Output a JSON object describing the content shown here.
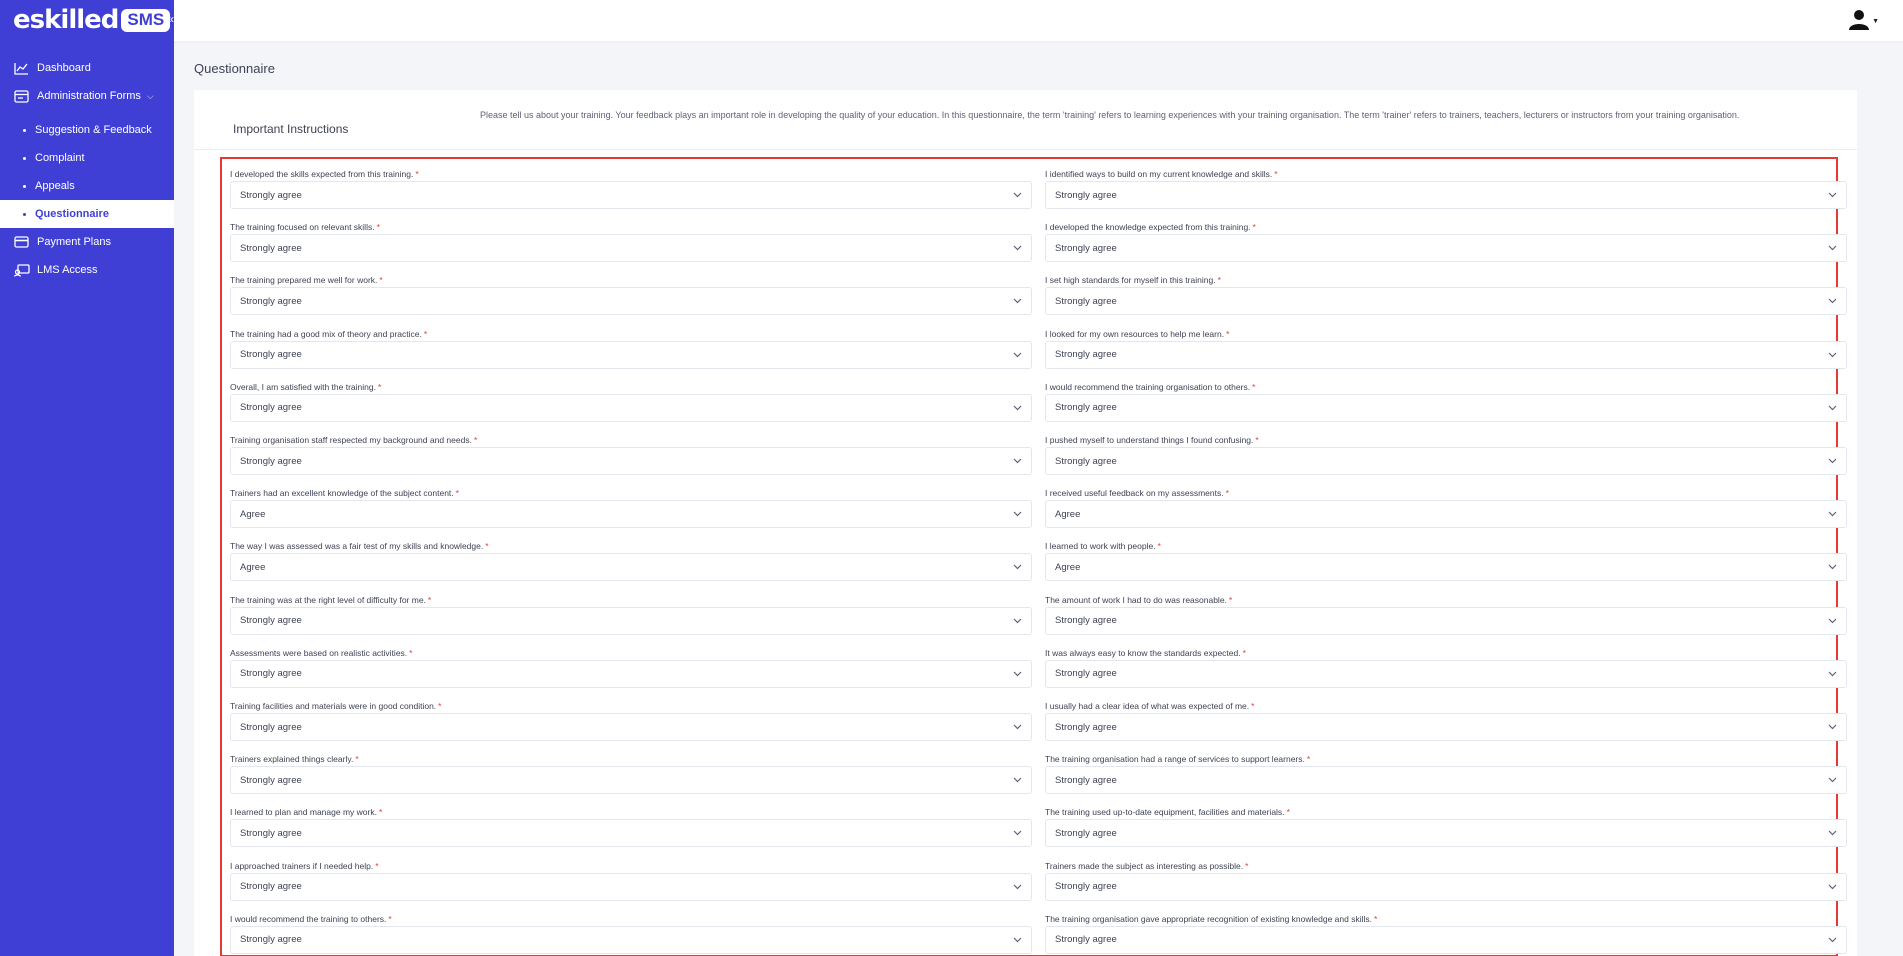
{
  "brand": {
    "logo": "eskilled",
    "badge": "SMS"
  },
  "sidebar": {
    "items": [
      {
        "label": "Dashboard",
        "icon": "chart-line-icon"
      },
      {
        "label": "Administration Forms",
        "icon": "forms-icon"
      },
      {
        "label": "Payment Plans",
        "icon": "credit-card-icon"
      },
      {
        "label": "LMS Access",
        "icon": "monitor-user-icon"
      }
    ],
    "subitems": [
      {
        "label": "Suggestion & Feedback"
      },
      {
        "label": "Complaint"
      },
      {
        "label": "Appeals"
      },
      {
        "label": "Questionnaire"
      }
    ]
  },
  "page": {
    "title": "Questionnaire",
    "instructions_heading": "Important Instructions",
    "instructions_text": "Please tell us about your training. Your feedback plays an important role in developing the quality of your education. In this questionnaire, the term 'training' refers to learning experiences with your training organisation. The term 'trainer' refers to trainers, teachers, lecturers or instructors from your training organisation."
  },
  "questions_left": [
    {
      "label": "I developed the skills expected from this training.",
      "value": "Strongly agree"
    },
    {
      "label": "The training focused on relevant skills.",
      "value": "Strongly agree"
    },
    {
      "label": "The training prepared me well for work.",
      "value": "Strongly agree"
    },
    {
      "label": "The training had a good mix of theory and practice.",
      "value": "Strongly agree"
    },
    {
      "label": "Overall, I am satisfied with the training.",
      "value": "Strongly agree"
    },
    {
      "label": "Training organisation staff respected my background and needs.",
      "value": "Strongly agree"
    },
    {
      "label": "Trainers had an excellent knowledge of the subject content.",
      "value": "Agree"
    },
    {
      "label": "The way I was assessed was a fair test of my skills and knowledge.",
      "value": "Agree"
    },
    {
      "label": "The training was at the right level of difficulty for me.",
      "value": "Strongly agree"
    },
    {
      "label": "Assessments were based on realistic activities.",
      "value": "Strongly agree"
    },
    {
      "label": "Training facilities and materials were in good condition.",
      "value": "Strongly agree"
    },
    {
      "label": "Trainers explained things clearly.",
      "value": "Strongly agree"
    },
    {
      "label": "I learned to plan and manage my work.",
      "value": "Strongly agree"
    },
    {
      "label": "I approached trainers if I needed help.",
      "value": "Strongly agree"
    },
    {
      "label": "I would recommend the training to others.",
      "value": "Strongly agree"
    }
  ],
  "questions_right": [
    {
      "label": "I identified ways to build on my current knowledge and skills.",
      "value": "Strongly agree"
    },
    {
      "label": "I developed the knowledge expected from this training.",
      "value": "Strongly agree"
    },
    {
      "label": "I set high standards for myself in this training.",
      "value": "Strongly agree"
    },
    {
      "label": "I looked for my own resources to help me learn.",
      "value": "Strongly agree"
    },
    {
      "label": "I would recommend the training organisation to others.",
      "value": "Strongly agree"
    },
    {
      "label": "I pushed myself to understand things I found confusing.",
      "value": "Strongly agree"
    },
    {
      "label": "I received useful feedback on my assessments.",
      "value": "Agree"
    },
    {
      "label": "I learned to work with people.",
      "value": "Agree"
    },
    {
      "label": "The amount of work I had to do was reasonable.",
      "value": "Strongly agree"
    },
    {
      "label": "It was always easy to know the standards expected.",
      "value": "Strongly agree"
    },
    {
      "label": "I usually had a clear idea of what was expected of me.",
      "value": "Strongly agree"
    },
    {
      "label": "The training organisation had a range of services to support learners.",
      "value": "Strongly agree"
    },
    {
      "label": "The training used up-to-date equipment, facilities and materials.",
      "value": "Strongly agree"
    },
    {
      "label": "Trainers made the subject as interesting as possible.",
      "value": "Strongly agree"
    },
    {
      "label": "The training organisation gave appropriate recognition of existing knowledge and skills.",
      "value": "Strongly agree"
    }
  ],
  "required_marker": "*",
  "colors": {
    "sidebar": "#3f3fd6",
    "highlight": "#e53935",
    "required": "#e53935"
  }
}
